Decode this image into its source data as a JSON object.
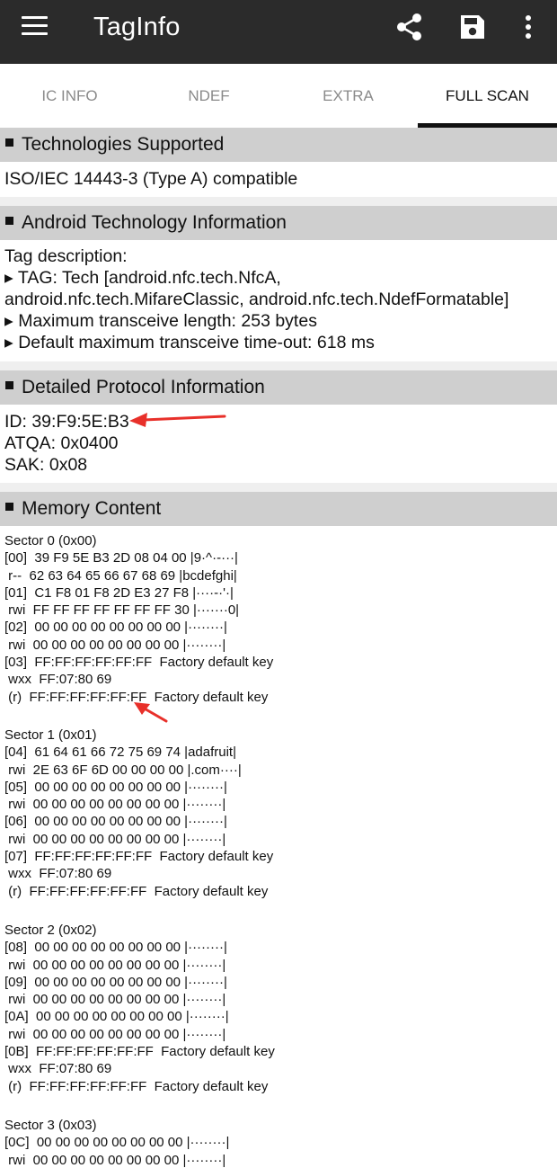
{
  "appbar": {
    "title": "TagInfo",
    "icons": [
      "menu-icon",
      "share-icon",
      "save-icon",
      "more-vert-icon"
    ]
  },
  "tabs": [
    {
      "label": "IC INFO",
      "active": false
    },
    {
      "label": "NDEF",
      "active": false
    },
    {
      "label": "EXTRA",
      "active": false
    },
    {
      "label": "FULL SCAN",
      "active": true
    }
  ],
  "sections": {
    "tech": {
      "title": "Technologies Supported",
      "lines": [
        "ISO/IEC 14443-3 (Type A) compatible"
      ]
    },
    "android": {
      "title": "Android Technology Information",
      "lines": [
        "Tag description:",
        "▸ TAG: Tech [android.nfc.tech.NfcA,",
        "android.nfc.tech.MifareClassic, android.nfc.tech.NdefFormatable]",
        "▸ Maximum transceive length: 253 bytes",
        "▸ Default maximum transceive time-out: 618 ms"
      ]
    },
    "protocol": {
      "title": "Detailed Protocol Information",
      "lines": [
        "ID: 39:F9:5E:B3",
        "ATQA: 0x0400",
        "SAK: 0x08"
      ]
    },
    "memory": {
      "title": "Memory Content",
      "sectors": [
        {
          "title": "Sector 0 (0x00)",
          "lines": [
            "[00]  39 F9 5E B3 2D 08 04 00 |9·^·-···|",
            " r--  62 63 64 65 66 67 68 69 |bcdefghi|",
            "[01]  C1 F8 01 F8 2D E3 27 F8 |····-·'·|",
            " rwi  FF FF FF FF FF FF FF 30 |·······0|",
            "[02]  00 00 00 00 00 00 00 00 |········|",
            " rwi  00 00 00 00 00 00 00 00 |········|",
            "[03]  FF:FF:FF:FF:FF:FF  Factory default key",
            " wxx  FF:07:80 69",
            " (r)  FF:FF:FF:FF:FF:FF  Factory default key"
          ]
        },
        {
          "title": "Sector 1 (0x01)",
          "lines": [
            "[04]  61 64 61 66 72 75 69 74 |adafruit|",
            " rwi  2E 63 6F 6D 00 00 00 00 |.com····|",
            "[05]  00 00 00 00 00 00 00 00 |········|",
            " rwi  00 00 00 00 00 00 00 00 |········|",
            "[06]  00 00 00 00 00 00 00 00 |········|",
            " rwi  00 00 00 00 00 00 00 00 |········|",
            "[07]  FF:FF:FF:FF:FF:FF  Factory default key",
            " wxx  FF:07:80 69",
            " (r)  FF:FF:FF:FF:FF:FF  Factory default key"
          ]
        },
        {
          "title": "Sector 2 (0x02)",
          "lines": [
            "[08]  00 00 00 00 00 00 00 00 |········|",
            " rwi  00 00 00 00 00 00 00 00 |········|",
            "[09]  00 00 00 00 00 00 00 00 |········|",
            " rwi  00 00 00 00 00 00 00 00 |········|",
            "[0A]  00 00 00 00 00 00 00 00 |········|",
            " rwi  00 00 00 00 00 00 00 00 |········|",
            "[0B]  FF:FF:FF:FF:FF:FF  Factory default key",
            " wxx  FF:07:80 69",
            " (r)  FF:FF:FF:FF:FF:FF  Factory default key"
          ]
        },
        {
          "title": "Sector 3 (0x03)",
          "lines": [
            "[0C]  00 00 00 00 00 00 00 00 |········|",
            " rwi  00 00 00 00 00 00 00 00 |········|"
          ]
        }
      ]
    }
  },
  "colors": {
    "appbar_bg": "#2b2b2b",
    "section_header_bg": "#cfcfcf",
    "annotation_arrow": "#e8302a"
  }
}
